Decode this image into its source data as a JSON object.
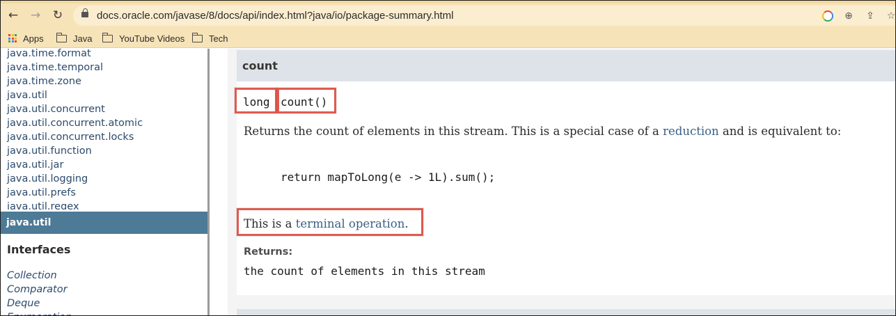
{
  "browser": {
    "url": "docs.oracle.com/javase/8/docs/api/index.html?java/io/package-summary.html",
    "nav": {
      "back_icon": "←",
      "forward_icon": "→",
      "reload_icon": "↻"
    },
    "omnibox_icons": {
      "zoom_icon": "⊕",
      "share_icon": "⇪",
      "star_icon": "☆"
    },
    "bookmarks": {
      "apps_label": "Apps",
      "apps_grid_colors": [
        "#ea4335",
        "#fbbc05",
        "#34a853",
        "#4285f4",
        "#ea4335",
        "#fbbc05",
        "#34a853",
        "#4285f4",
        "#ea4335"
      ],
      "folders": [
        {
          "label": "Java"
        },
        {
          "label": "YouTube Videos"
        },
        {
          "label": "Tech"
        }
      ]
    }
  },
  "package_list": [
    "java.time.format",
    "java.time.temporal",
    "java.time.zone",
    "java.util",
    "java.util.concurrent",
    "java.util.concurrent.atomic",
    "java.util.concurrent.locks",
    "java.util.function",
    "java.util.jar",
    "java.util.logging",
    "java.util.prefs",
    "java.util.regex"
  ],
  "package_frame": {
    "title": "java.util",
    "interfaces_heading": "Interfaces",
    "interfaces": [
      "Collection",
      "Comparator",
      "Deque",
      "Enumeration"
    ]
  },
  "member": {
    "title": "count",
    "return_type": "long",
    "signature": "count()",
    "description": {
      "before": "Returns the count of elements in this stream. This is a special case of a ",
      "link": "reduction",
      "after": " and is equivalent to:"
    },
    "code": "return mapToLong(e -> 1L).sum();",
    "terminal": {
      "before": "This is a ",
      "link": "terminal operation",
      "after": "."
    },
    "returns_label": "Returns:",
    "returns_value": "the count of elements in this stream"
  },
  "colors": {
    "highlight": "#e05a4f",
    "link": "#3b5f86",
    "package_bar": "#4d7a97",
    "member_header": "#dee3e9"
  }
}
